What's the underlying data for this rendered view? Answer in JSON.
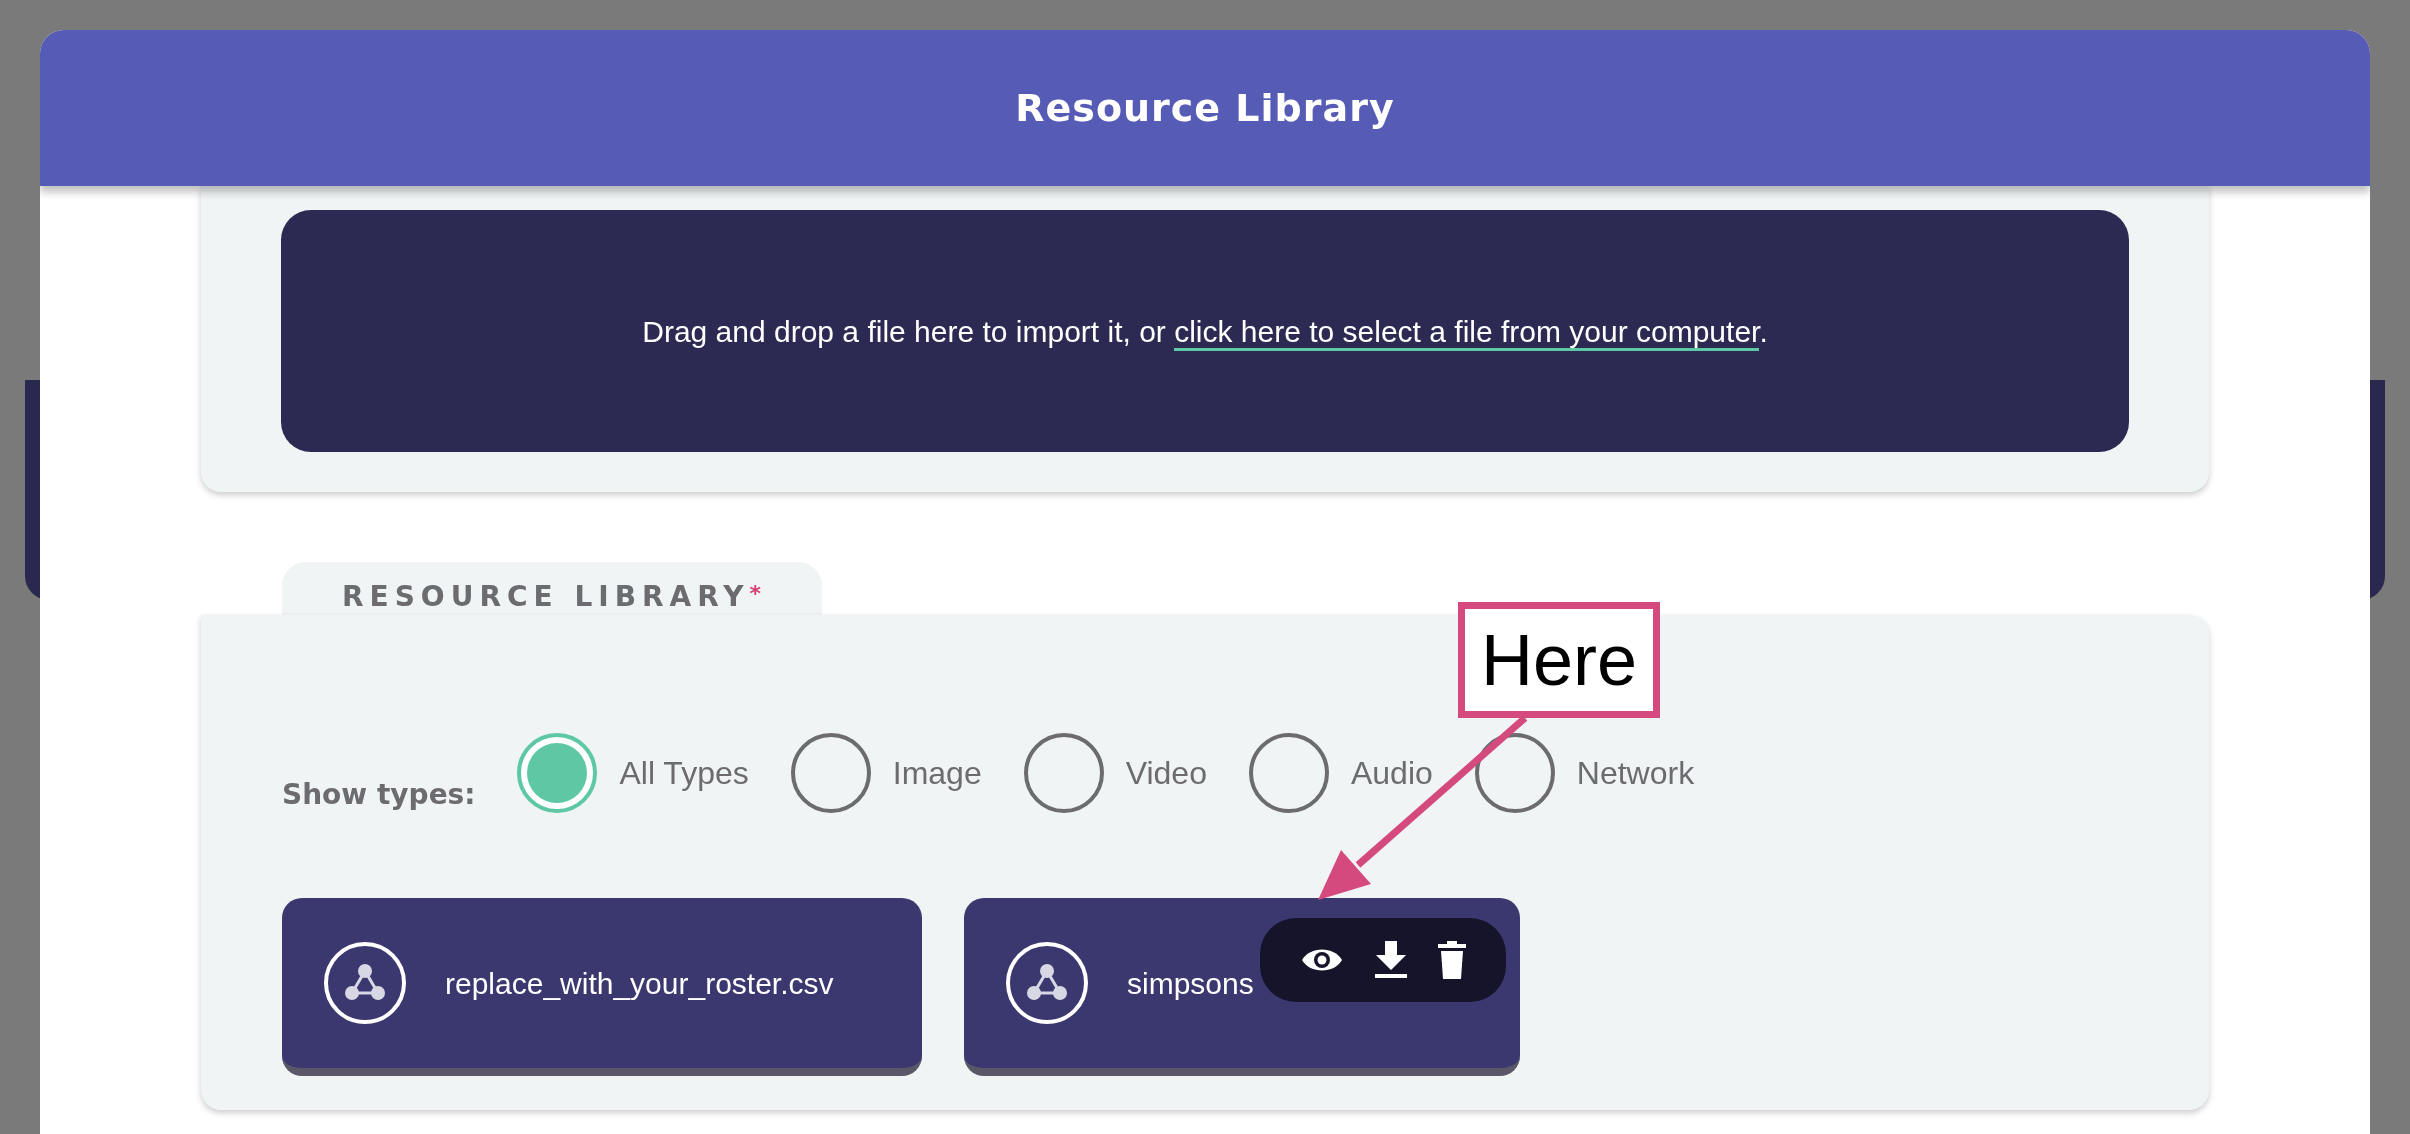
{
  "dialog": {
    "title": "Resource Library"
  },
  "import_zone": {
    "text": "Drag and drop a file here to import it, or ",
    "link": "click here to select a file from your computer",
    "suffix": "."
  },
  "library": {
    "tab_label": "RESOURCE LIBRARY",
    "required_mark": "*",
    "filter_label": "Show types:",
    "types": [
      {
        "label": "All Types",
        "selected": true
      },
      {
        "label": "Image",
        "selected": false
      },
      {
        "label": "Video",
        "selected": false
      },
      {
        "label": "Audio",
        "selected": false
      },
      {
        "label": "Network",
        "selected": false
      }
    ],
    "files": [
      {
        "name": "replace_with_your_roster.csv",
        "show_actions": false
      },
      {
        "name": "simpsons",
        "show_actions": true
      }
    ]
  },
  "annotation": {
    "text": "Here"
  }
}
